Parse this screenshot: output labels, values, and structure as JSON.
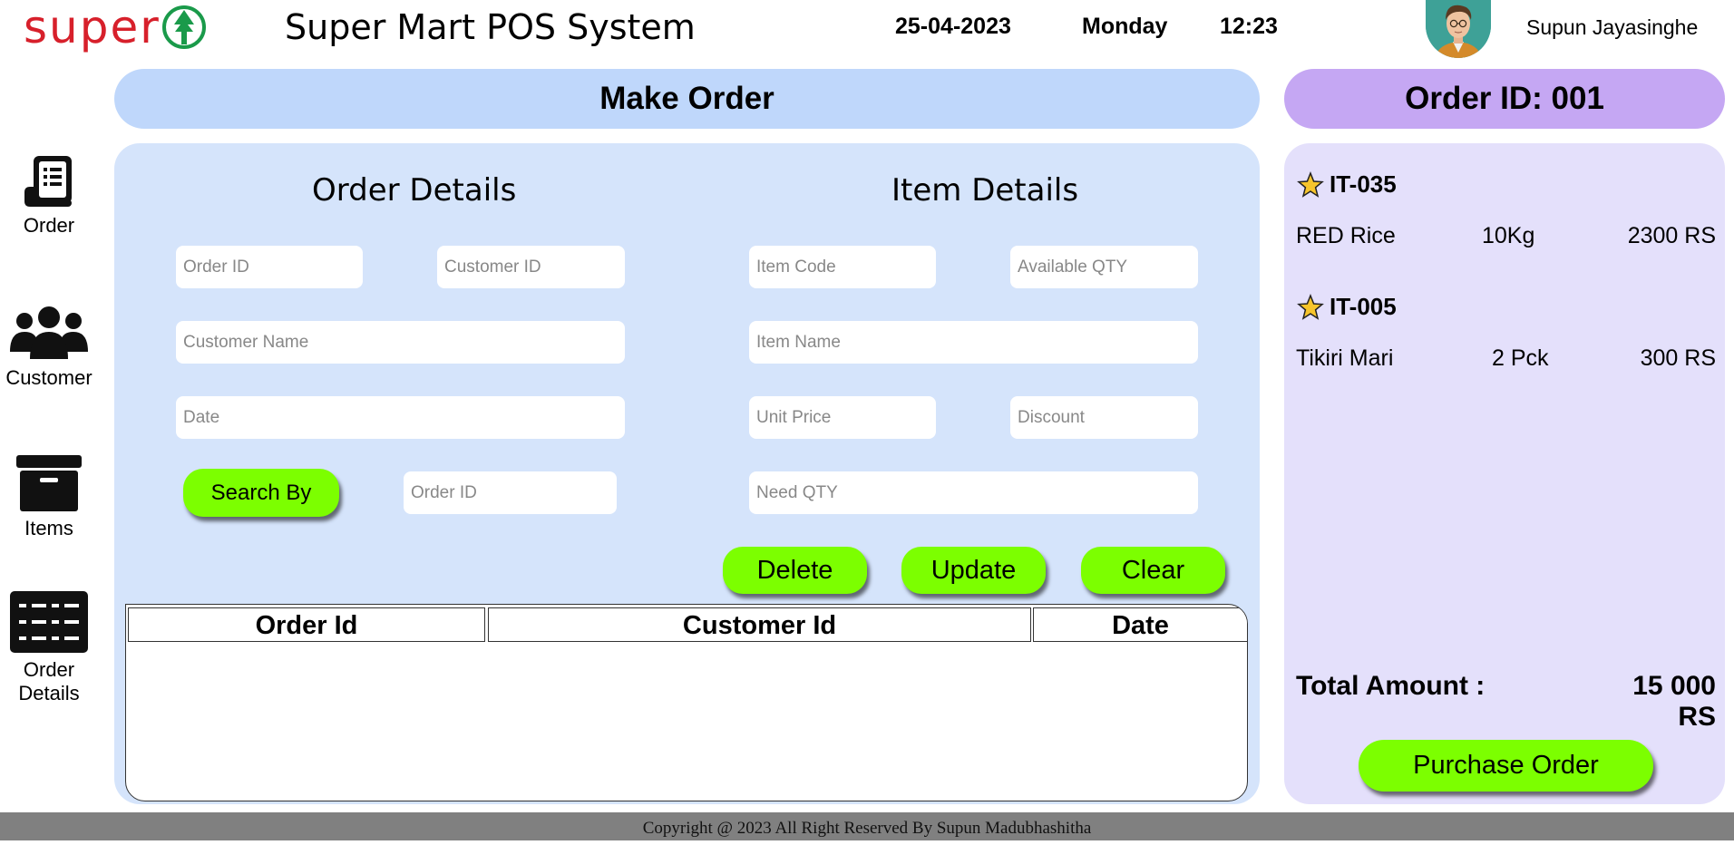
{
  "header": {
    "logo_text": "super",
    "app_title": "Super Mart POS System",
    "date": "25-04-2023",
    "day": "Monday",
    "time": "12:23",
    "user_name": "Supun Jayasinghe"
  },
  "sidebar": {
    "items": [
      {
        "label": "Order",
        "icon": "receipt-icon"
      },
      {
        "label": "Customer",
        "icon": "users-icon"
      },
      {
        "label": "Items",
        "icon": "box-icon"
      },
      {
        "label": "Order Details",
        "icon": "grid-list-icon"
      }
    ]
  },
  "make_order": {
    "title": "Make Order",
    "order_details_title": "Order Details",
    "item_details_title": "Item Details",
    "fields": {
      "order_id": "Order ID",
      "customer_id": "Customer ID",
      "customer_name": "Customer Name",
      "date": "Date",
      "search_order_id": "Order ID",
      "item_code": "Item Code",
      "available_qty": "Available QTY",
      "item_name": "Item Name",
      "unit_price": "Unit Price",
      "discount": "Discount",
      "need_qty": "Need QTY"
    },
    "buttons": {
      "search_by": "Search By",
      "delete": "Delete",
      "update": "Update",
      "clear": "Clear"
    },
    "table": {
      "columns": [
        "Order Id",
        "Customer Id",
        "Date"
      ],
      "rows": []
    }
  },
  "order_summary": {
    "title": "Order ID: 001",
    "items": [
      {
        "code": "IT-035",
        "name": "RED Rice",
        "qty": "10Kg",
        "price": "2300 RS"
      },
      {
        "code": "IT-005",
        "name": "Tikiri Mari",
        "qty": "2 Pck",
        "price": "300 RS"
      }
    ],
    "total_label": "Total Amount :",
    "total_value": "15 000 RS",
    "purchase_label": "Purchase Order"
  },
  "footer": {
    "text": "Copyright @ 2023 All Right Reserved By Supun Madubhashitha"
  },
  "colors": {
    "accent_green": "#7cff00",
    "banner_blue": "#bfd7fb",
    "panel_blue": "#d5e4fb",
    "banner_purple": "#c5a7f3",
    "panel_lavender": "#e4e0fb",
    "logo_red": "#d7202b",
    "logo_green": "#1a9a4a",
    "footer_gray": "#808080"
  }
}
